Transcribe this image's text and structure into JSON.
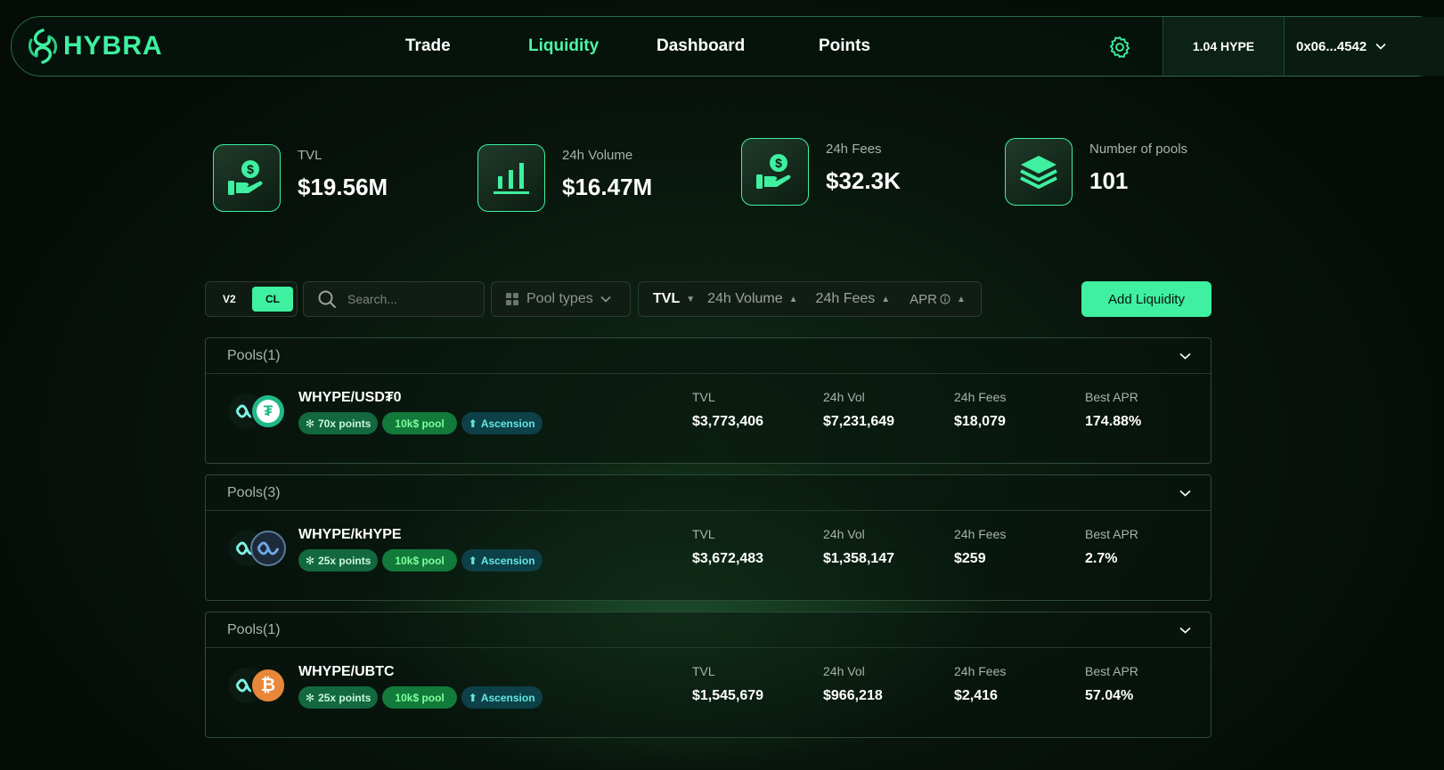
{
  "brand": {
    "name": "HYBRA",
    "color": "#3ef0a0"
  },
  "nav": {
    "links": [
      {
        "label": "Trade",
        "active": false
      },
      {
        "label": "Liquidity",
        "active": true
      },
      {
        "label": "Dashboard",
        "active": false
      },
      {
        "label": "Points",
        "active": false
      }
    ],
    "settings_icon": "gear-icon",
    "balance": "1.04 HYPE",
    "wallet": "0x06...4542"
  },
  "stats": [
    {
      "label": "TVL",
      "value": "$19.56M",
      "icon": "hand-dollar-icon"
    },
    {
      "label": "24h Volume",
      "value": "$16.47M",
      "icon": "bar-chart-icon"
    },
    {
      "label": "24h Fees",
      "value": "$32.3K",
      "icon": "hand-dollar-icon"
    },
    {
      "label": "Number of pools",
      "value": "101",
      "icon": "layers-icon"
    }
  ],
  "filters": {
    "version_toggle": {
      "v2": "V2",
      "cl": "CL",
      "selected": "CL"
    },
    "search_placeholder": "Search...",
    "pool_types": "Pool types",
    "sorts": [
      {
        "label": "TVL",
        "active": true,
        "direction": "desc"
      },
      {
        "label": "24h Volume",
        "active": false,
        "direction": "asc"
      },
      {
        "label": "24h Fees",
        "active": false,
        "direction": "asc"
      },
      {
        "label": "APR",
        "active": false,
        "direction": "asc"
      }
    ],
    "add_liquidity": "Add Liquidity"
  },
  "pools": [
    {
      "group": "Pools(1)",
      "pair": "WHYPE/USD₮0",
      "token_b_color": "#1fb98a",
      "token_b_symbol": "₮",
      "badges": {
        "points": "70x points",
        "size": "10k$ pool",
        "tag": "Ascension"
      },
      "metrics": {
        "tvl_label": "TVL",
        "tvl": "$3,773,406",
        "vol_label": "24h Vol",
        "vol": "$7,231,649",
        "fees_label": "24h Fees",
        "fees": "$18,079",
        "apr_label": "Best APR",
        "apr": "174.88%"
      }
    },
    {
      "group": "Pools(3)",
      "pair": "WHYPE/kHYPE",
      "token_b_color": "#1c2a3a",
      "token_b_symbol": "",
      "badges": {
        "points": "25x points",
        "size": "10k$ pool",
        "tag": "Ascension"
      },
      "metrics": {
        "tvl_label": "TVL",
        "tvl": "$3,672,483",
        "vol_label": "24h Vol",
        "vol": "$1,358,147",
        "fees_label": "24h Fees",
        "fees": "$259",
        "apr_label": "Best APR",
        "apr": "2.7%"
      }
    },
    {
      "group": "Pools(1)",
      "pair": "WHYPE/UBTC",
      "token_b_color": "#e8873a",
      "token_b_symbol": "₿",
      "badges": {
        "points": "25x points",
        "size": "10k$ pool",
        "tag": "Ascension"
      },
      "metrics": {
        "tvl_label": "TVL",
        "tvl": "$1,545,679",
        "vol_label": "24h Vol",
        "vol": "$966,218",
        "fees_label": "24h Fees",
        "fees": "$2,416",
        "apr_label": "Best APR",
        "apr": "57.04%"
      }
    }
  ]
}
